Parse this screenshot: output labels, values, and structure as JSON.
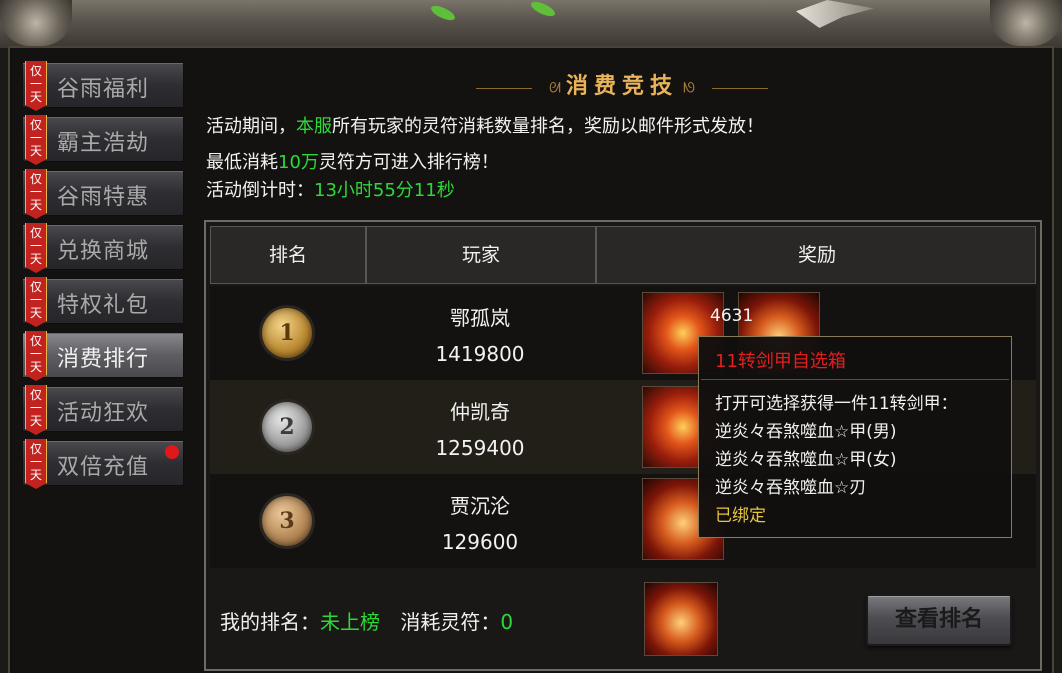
{
  "sidebar": {
    "items": [
      {
        "tag": "仅一天",
        "label": "谷雨福利"
      },
      {
        "tag": "仅一天",
        "label": "霸主浩劫"
      },
      {
        "tag": "仅一天",
        "label": "谷雨特惠"
      },
      {
        "tag": "仅一天",
        "label": "兑换商城"
      },
      {
        "tag": "仅一天",
        "label": "特权礼包"
      },
      {
        "tag": "仅一天",
        "label": "消费排行"
      },
      {
        "tag": "仅一天",
        "label": "活动狂欢"
      },
      {
        "tag": "仅一天",
        "label": "双倍充值"
      }
    ],
    "active_index": 5
  },
  "main": {
    "title": "消费竞技",
    "line1_a": "活动期间，",
    "line1_hl": "本服",
    "line1_b": "所有玩家的灵符消耗数量排名，奖励以邮件形式发放！",
    "line2_a": "最低消耗",
    "line2_hl": "10万",
    "line2_b": "灵符方可进入排行榜！",
    "line3_a": "活动倒计时：",
    "line3_hl": "13小时55分11秒"
  },
  "table": {
    "headers": {
      "rank": "排名",
      "player": "玩家",
      "reward": "奖励"
    },
    "rows": [
      {
        "rank": "1",
        "name": "鄂孤岚",
        "value": "1419800"
      },
      {
        "rank": "2",
        "name": "仲凯奇",
        "value": "1259400"
      },
      {
        "rank": "3",
        "name": "贾沉沦",
        "value": "129600"
      }
    ],
    "first_reward_count": "4631"
  },
  "tooltip": {
    "title": "11转剑甲自选箱",
    "desc": "打开可选择获得一件11转剑甲：",
    "options": [
      "逆炎々吞煞噬血☆甲(男)",
      "逆炎々吞煞噬血☆甲(女)",
      "逆炎々吞煞噬血☆刃"
    ],
    "bound": "已绑定"
  },
  "footer": {
    "my_rank_label": "我的排名：",
    "my_rank_value": "未上榜",
    "consume_label": "消耗灵符：",
    "consume_value": "0",
    "view_button": "查看排名"
  }
}
